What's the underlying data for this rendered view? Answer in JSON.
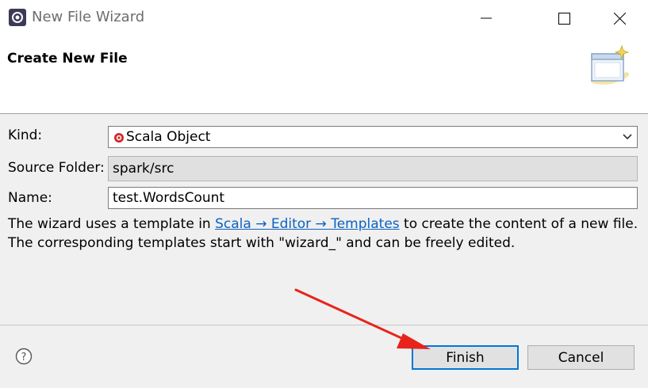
{
  "window": {
    "title": "New File Wizard"
  },
  "header": {
    "title": "Create New File"
  },
  "form": {
    "kind_label": "Kind:",
    "kind_value": "Scala Object",
    "source_folder_label": "Source Folder:",
    "source_folder_value": "spark/src",
    "name_label": "Name:",
    "name_value": "test.WordsCount"
  },
  "description": {
    "line1_prefix": "The wizard uses a template in ",
    "link_text": "Scala → Editor → Templates",
    "line1_suffix": " to create the content of a new file.",
    "line2": "The corresponding templates start with \"wizard_\" and can be freely edited."
  },
  "buttons": {
    "finish": "Finish",
    "cancel": "Cancel"
  },
  "colors": {
    "annotation_arrow": "#e8231b",
    "link": "#0b62c4",
    "default_button_border": "#0078d7"
  }
}
